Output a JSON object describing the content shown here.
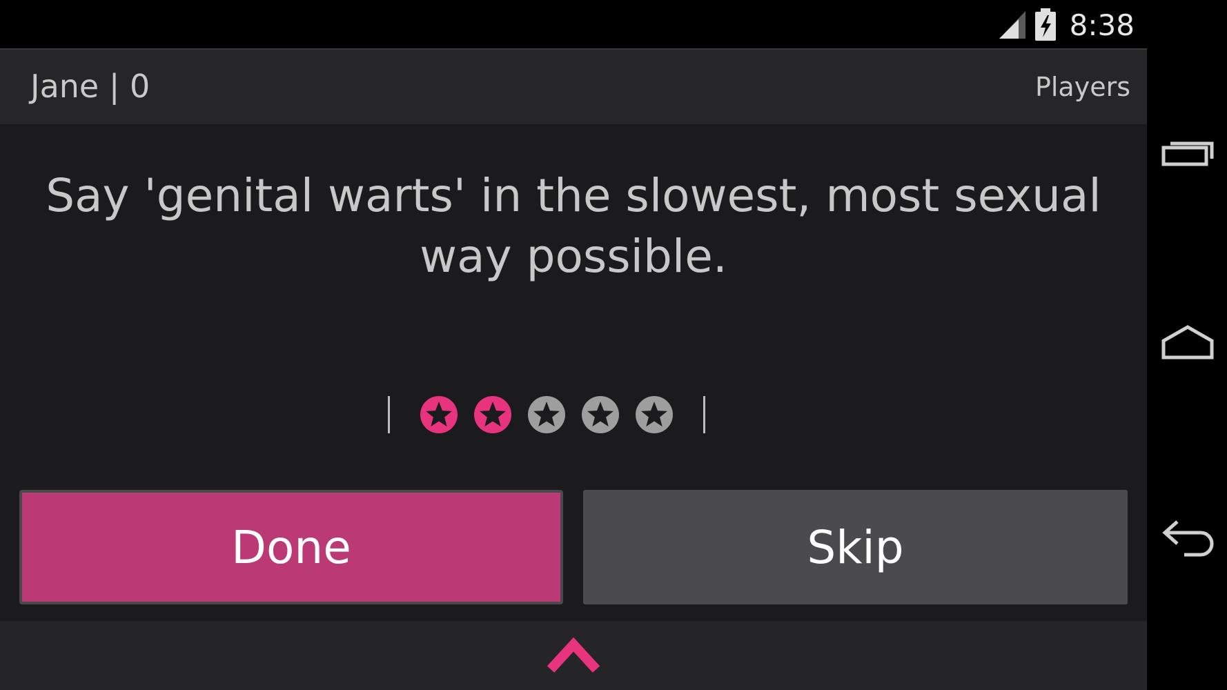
{
  "status_bar": {
    "time": "8:38",
    "signal_icon": "signal-icon",
    "battery_icon": "battery-charging-icon"
  },
  "action_bar": {
    "player_score": "Jane | 0",
    "players_label": "Players"
  },
  "prompt": {
    "text": "Say 'genital warts' in the slowest, most sexual way possible."
  },
  "rating": {
    "value": 2,
    "max": 5,
    "active_color": "#e8337f",
    "inactive_color": "#9e9e9e"
  },
  "buttons": {
    "done_label": "Done",
    "skip_label": "Skip"
  },
  "colors": {
    "accent": "#bb3a75",
    "chevron": "#e8337f",
    "background": "#1b1b1d"
  },
  "nav_bar": {
    "recents_icon": "recent-apps-icon",
    "home_icon": "home-icon",
    "back_icon": "back-icon"
  }
}
